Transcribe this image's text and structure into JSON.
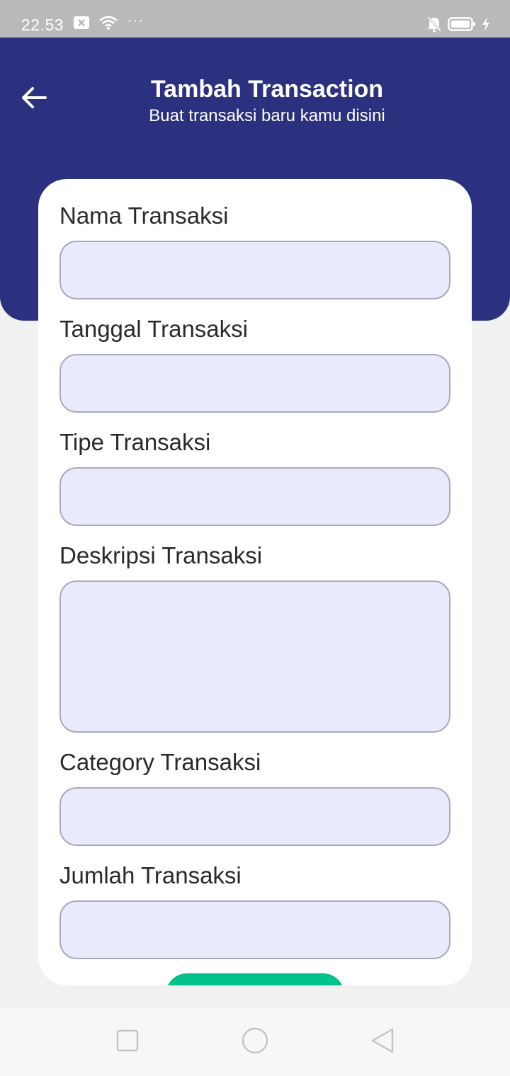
{
  "status_bar": {
    "time": "22.53",
    "dots": "···",
    "icons": [
      "notification-x-icon",
      "wifi-icon",
      "silent-bell-icon",
      "battery-icon",
      "charging-bolt-icon"
    ]
  },
  "header": {
    "title": "Tambah Transaction",
    "subtitle": "Buat transaksi baru kamu disini",
    "background_color": "#2b317e",
    "back_icon": "arrow-left-icon"
  },
  "form": {
    "fields": [
      {
        "label": "Nama Transaksi",
        "value": "",
        "type": "text"
      },
      {
        "label": "Tanggal Transaksi",
        "value": "",
        "type": "text"
      },
      {
        "label": "Tipe Transaksi",
        "value": "",
        "type": "text"
      },
      {
        "label": "Deskripsi Transaksi",
        "value": "",
        "type": "textarea"
      },
      {
        "label": "Category Transaksi",
        "value": "",
        "type": "text"
      },
      {
        "label": "Jumlah Transaksi",
        "value": "",
        "type": "text"
      }
    ],
    "input_background": "#e9eafc",
    "submit_button_color": "#00c28a"
  },
  "nav_bar": {
    "items": [
      "recents-square-icon",
      "home-circle-icon",
      "back-triangle-icon"
    ]
  }
}
